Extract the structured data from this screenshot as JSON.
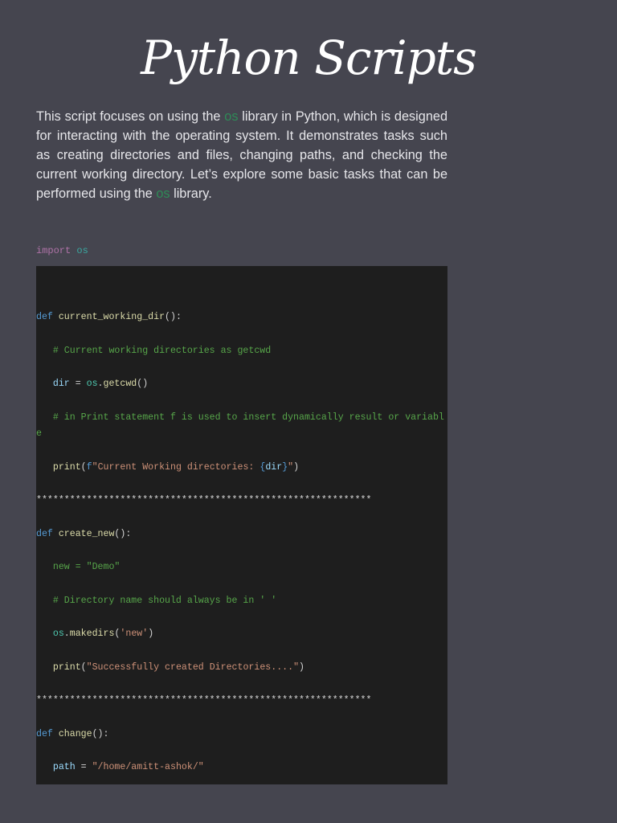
{
  "title": "Python Scripts",
  "intro": {
    "p1": "This script focuses on using the ",
    "hl1": "os",
    "p2": " library in Python, which is designed for interacting with the operating system. It demonstrates tasks such as creating directories and files, changing paths, and checking the current working directory. Let’s explore some basic tasks that can be performed using the ",
    "hl2": "os",
    "p3": " library."
  },
  "import_line": {
    "keyword": "import",
    "module": "os"
  },
  "code_lines": [
    [
      [
        "kw",
        "def"
      ],
      [
        "p",
        " "
      ],
      [
        "fn",
        "current_working_dir"
      ],
      [
        "p",
        "():"
      ]
    ],
    [
      [
        "cm",
        "   # Current working directories as getcwd"
      ]
    ],
    [
      [
        "p",
        "   "
      ],
      [
        "var",
        "dir"
      ],
      [
        "p",
        " = "
      ],
      [
        "mod",
        "os"
      ],
      [
        "p",
        "."
      ],
      [
        "fn",
        "getcwd"
      ],
      [
        "p",
        "()"
      ]
    ],
    [
      [
        "cm",
        "   # in Print statement f is used to insert dynamically result or variable"
      ]
    ],
    [
      [
        "p",
        "   "
      ],
      [
        "fn",
        "print"
      ],
      [
        "p",
        "("
      ],
      [
        "kw",
        "f"
      ],
      [
        "str",
        "\"Current Working directories: "
      ],
      [
        "br",
        "{"
      ],
      [
        "var",
        "dir"
      ],
      [
        "br",
        "}"
      ],
      [
        "str",
        "\""
      ],
      [
        "p",
        ")"
      ]
    ],
    [
      [
        "star",
        "************************************************************"
      ]
    ],
    [
      [
        "kw",
        "def"
      ],
      [
        "p",
        " "
      ],
      [
        "fn",
        "create_new"
      ],
      [
        "p",
        "():"
      ]
    ],
    [
      [
        "cm",
        "   new = \"Demo\""
      ]
    ],
    [
      [
        "cm",
        "   # Directory name should always be in ' '"
      ]
    ],
    [
      [
        "p",
        "   "
      ],
      [
        "mod",
        "os"
      ],
      [
        "p",
        "."
      ],
      [
        "fn",
        "makedirs"
      ],
      [
        "p",
        "("
      ],
      [
        "str",
        "'new'"
      ],
      [
        "p",
        ")"
      ]
    ],
    [
      [
        "p",
        "   "
      ],
      [
        "fn",
        "print"
      ],
      [
        "p",
        "("
      ],
      [
        "str",
        "\"Successfully created Directories....\""
      ],
      [
        "p",
        ")"
      ]
    ],
    [
      [
        "star",
        "************************************************************"
      ]
    ],
    [
      [
        "kw",
        "def"
      ],
      [
        "p",
        " "
      ],
      [
        "fn",
        "change"
      ],
      [
        "p",
        "():"
      ]
    ],
    [
      [
        "p",
        "   "
      ],
      [
        "var",
        "path"
      ],
      [
        "p",
        " = "
      ],
      [
        "str",
        "\"/home/amitt-ashok/\""
      ]
    ]
  ],
  "colors": {
    "background": "#45454f",
    "code_bg": "#1e1e1e",
    "highlight": "#2e8b57"
  }
}
